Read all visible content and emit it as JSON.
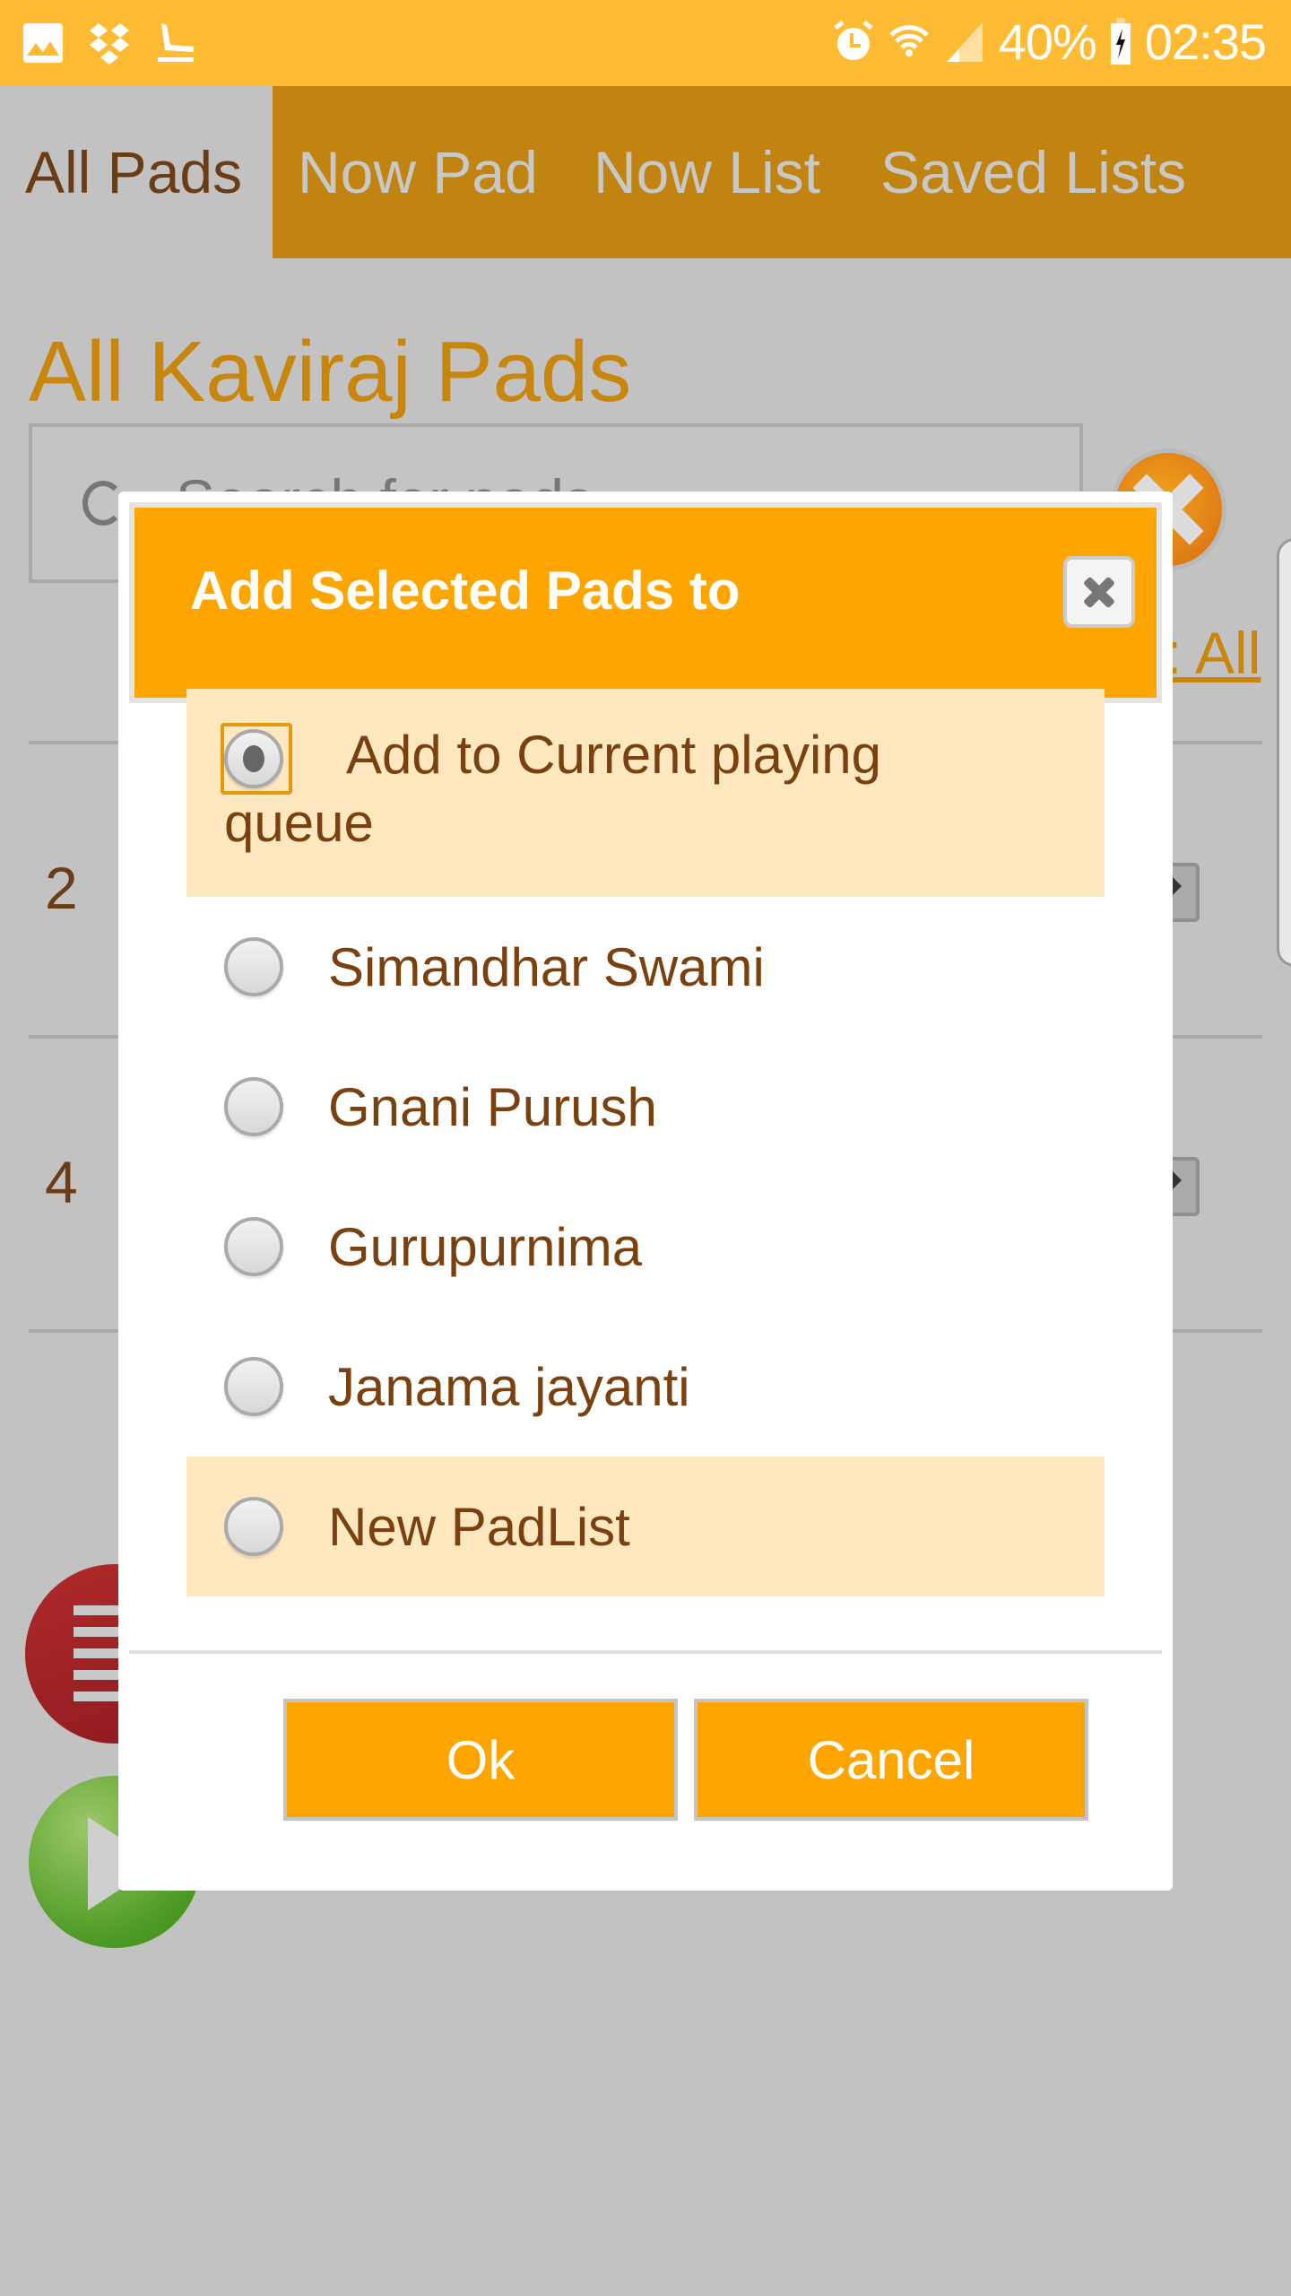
{
  "status_bar": {
    "left_icons": [
      "gallery-icon",
      "dropbox-icon",
      "airplane-landing-icon"
    ],
    "right_icons": [
      "alarm-icon",
      "wifi-icon",
      "signal-icon"
    ],
    "battery_percent": "40%",
    "time": "02:35"
  },
  "tabs": [
    {
      "label": "All Pads",
      "active": true
    },
    {
      "label": "Now Pad",
      "active": false
    },
    {
      "label": "Now List",
      "active": false
    },
    {
      "label": "Saved Lists",
      "active": false
    }
  ],
  "page": {
    "title": "All Kaviraj Pads",
    "search_placeholder": "Search for pads",
    "select_all_label": ": All",
    "rows": [
      {
        "number": "2"
      },
      {
        "number": "4"
      }
    ]
  },
  "dialog": {
    "title": "Add Selected Pads to",
    "options": [
      {
        "label": "Add to Current playing queue",
        "selected": true,
        "highlighted": true
      },
      {
        "label": "Simandhar Swami",
        "selected": false,
        "highlighted": false
      },
      {
        "label": "Gnani Purush",
        "selected": false,
        "highlighted": false
      },
      {
        "label": "Gurupurnima",
        "selected": false,
        "highlighted": false
      },
      {
        "label": "Janama jayanti",
        "selected": false,
        "highlighted": false
      },
      {
        "label": "New PadList",
        "selected": false,
        "highlighted": true
      }
    ],
    "ok_label": "Ok",
    "cancel_label": "Cancel"
  },
  "colors": {
    "status_bar": "#ffbb33",
    "tab_bar": "#c18411",
    "accent": "#ffa500",
    "text_brown": "#7a4110",
    "highlight": "#ffe8bf",
    "overlay_gray": "#c2c2c2"
  }
}
